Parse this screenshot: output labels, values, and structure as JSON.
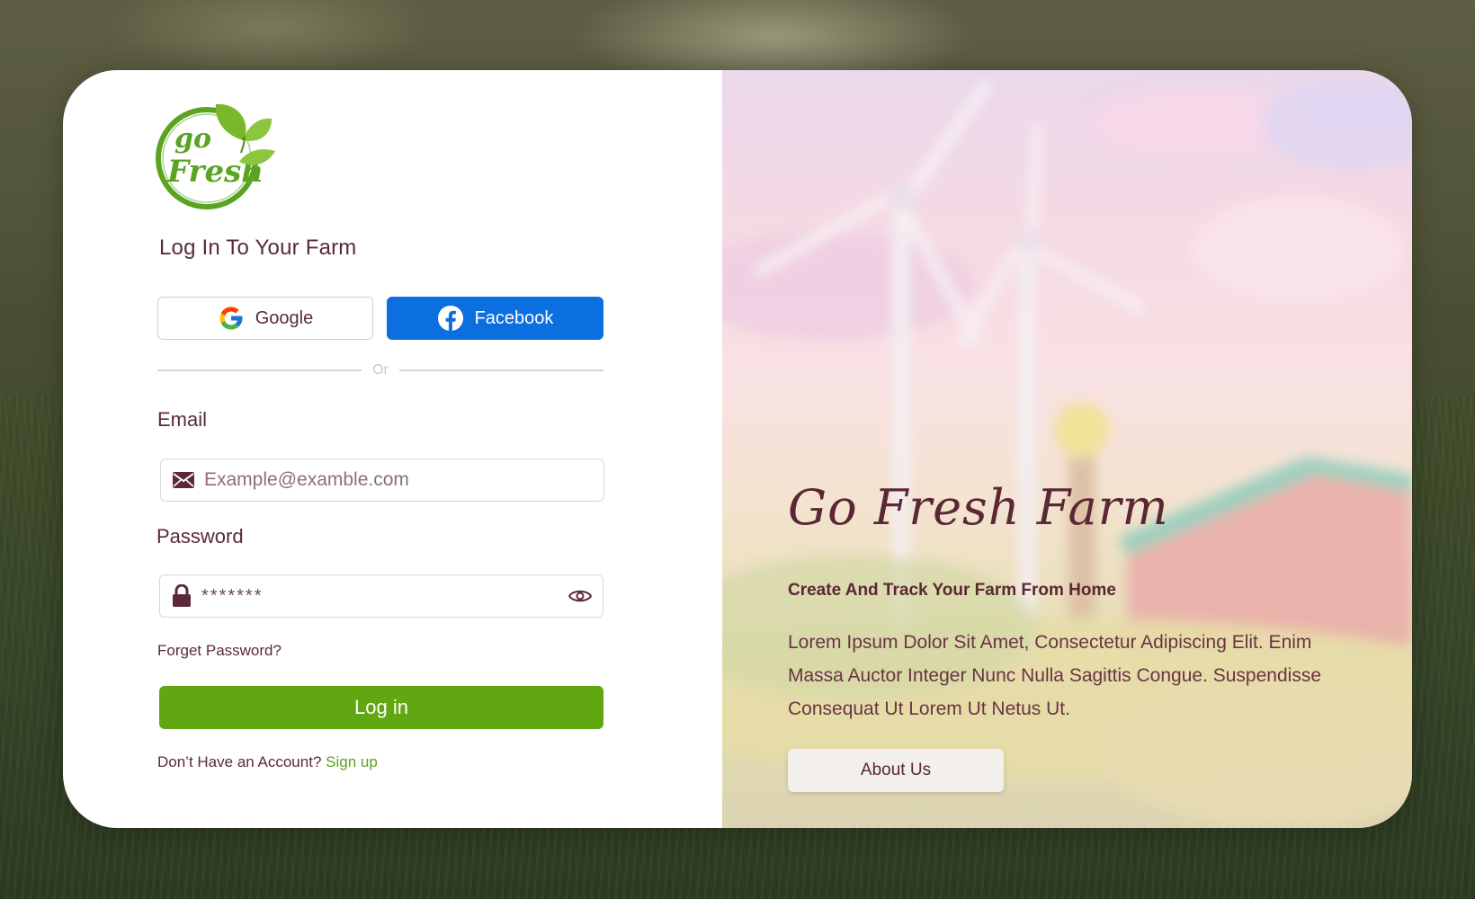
{
  "brand": {
    "logo_alt": "go Fresh"
  },
  "login": {
    "heading": "Log In To Your Farm",
    "google_label": "Google",
    "facebook_label": "Facebook",
    "divider_text": "Or",
    "email_label": "Email",
    "email_placeholder": "Example@examble.com",
    "password_label": "Password",
    "password_value": "*******",
    "forgot_label": "Forget Password?",
    "login_label": "Log in",
    "signup_prompt": "Don’t Have an Account?",
    "signup_label": "Sign up"
  },
  "hero": {
    "title": "Go Fresh Farm",
    "tagline": "Create And Track Your Farm From Home",
    "description": "Lorem Ipsum Dolor Sit Amet, Consectetur Adipiscing Elit. Enim Massa Auctor Integer Nunc Nulla Sagittis Congue. Suspendisse Consequat Ut Lorem Ut Netus Ut.",
    "about_label": "About Us"
  },
  "icons": {
    "email": "envelope-icon",
    "password": "lock-icon",
    "toggle": "eye-icon",
    "google": "google-icon",
    "facebook": "facebook-icon"
  },
  "colors": {
    "primary_text": "#5a2a3a",
    "accent_green": "#62a612",
    "facebook_blue": "#0c6fe0"
  }
}
